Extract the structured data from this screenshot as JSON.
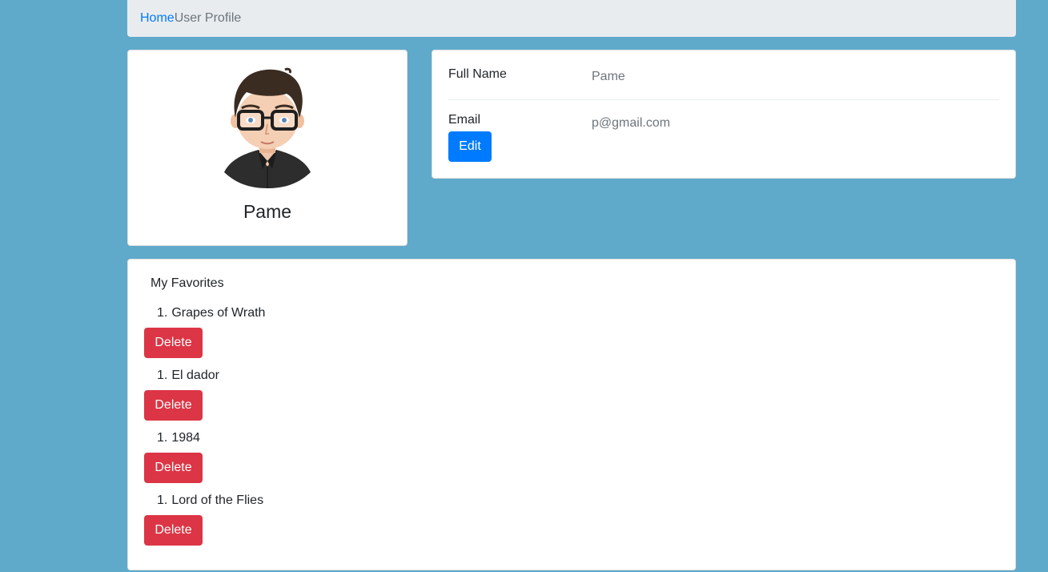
{
  "breadcrumb": {
    "home": "Home",
    "current": "User Profile"
  },
  "profile": {
    "name": "Pame",
    "avatar_icon": "avatar-icon"
  },
  "info": {
    "full_name_label": "Full Name",
    "full_name_value": "Pame",
    "email_label": "Email",
    "email_value": "p@gmail.com",
    "edit_label": "Edit"
  },
  "favorites": {
    "title": "My Favorites",
    "delete_label": "Delete",
    "items": [
      {
        "number": "1.",
        "title": "Grapes of Wrath"
      },
      {
        "number": "1.",
        "title": "El dador"
      },
      {
        "number": "1.",
        "title": "1984"
      },
      {
        "number": "1.",
        "title": "Lord of the Flies"
      }
    ]
  },
  "colors": {
    "background": "#5faacb",
    "primary": "#007bff",
    "danger": "#dc3545",
    "breadcrumb_bg": "#e9ecef"
  }
}
